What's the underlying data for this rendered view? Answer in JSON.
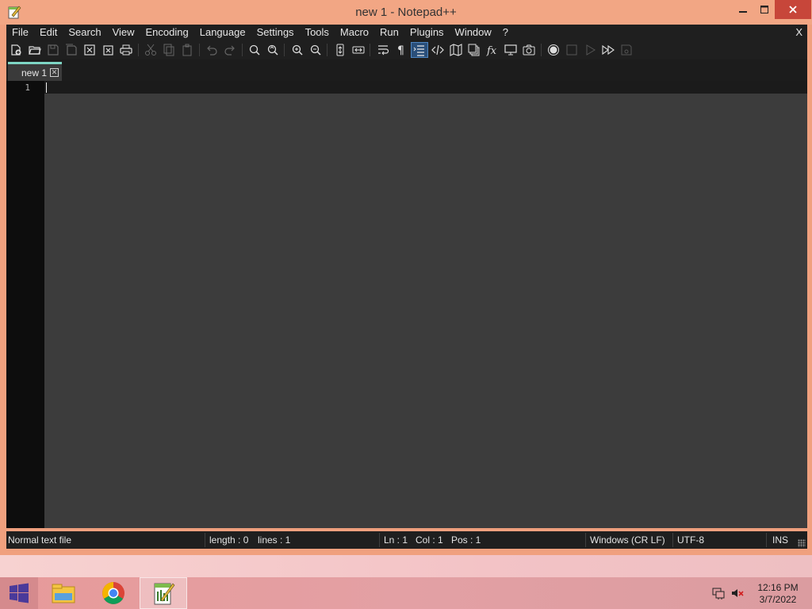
{
  "window": {
    "title": "new 1 - Notepad++",
    "minimize_icon": "minimize-icon",
    "maximize_icon": "maximize-icon",
    "close_icon": "close-icon"
  },
  "menu": {
    "items": [
      "File",
      "Edit",
      "Search",
      "View",
      "Encoding",
      "Language",
      "Settings",
      "Tools",
      "Macro",
      "Run",
      "Plugins",
      "Window",
      "?"
    ],
    "close_label": "X"
  },
  "toolbar": {
    "icons": [
      "new-file-icon",
      "open-file-icon",
      "save-icon",
      "save-all-icon",
      "close-icon",
      "close-all-icon",
      "print-icon",
      "cut-icon",
      "copy-icon",
      "paste-icon",
      "undo-icon",
      "redo-icon",
      "find-icon",
      "replace-icon",
      "zoom-in-icon",
      "zoom-out-icon",
      "sync-vertical-icon",
      "sync-horizontal-icon",
      "word-wrap-icon",
      "show-all-characters-icon",
      "indent-guide-icon",
      "language-tag-icon",
      "document-map-icon",
      "document-list-icon",
      "function-list-icon",
      "monitor-icon",
      "screenshot-icon",
      "record-macro-icon",
      "stop-macro-icon",
      "play-macro-icon",
      "run-macro-multiple-icon",
      "save-macro-icon"
    ]
  },
  "tabs": [
    {
      "label": "new 1",
      "active": true
    }
  ],
  "editor": {
    "line_numbers": [
      "1"
    ],
    "content": ""
  },
  "status": {
    "file_type": "Normal text file",
    "length": "length : 0",
    "lines": "lines : 1",
    "ln": "Ln : 1",
    "col": "Col : 1",
    "pos": "Pos : 1",
    "eol": "Windows (CR LF)",
    "encoding": "UTF-8",
    "mode": "INS"
  },
  "taskbar": {
    "apps": [
      "start-icon",
      "file-explorer-icon",
      "chrome-icon",
      "notepad-plus-plus-icon"
    ],
    "tray": [
      "network-icon",
      "volume-muted-icon"
    ],
    "time": "12:16 PM",
    "date": "3/7/2022"
  },
  "colors": {
    "accent": "#7ed6c4",
    "window_frame": "#f0a07e",
    "close_button": "#c7463a",
    "editor_bg": "#3c3c3c"
  }
}
